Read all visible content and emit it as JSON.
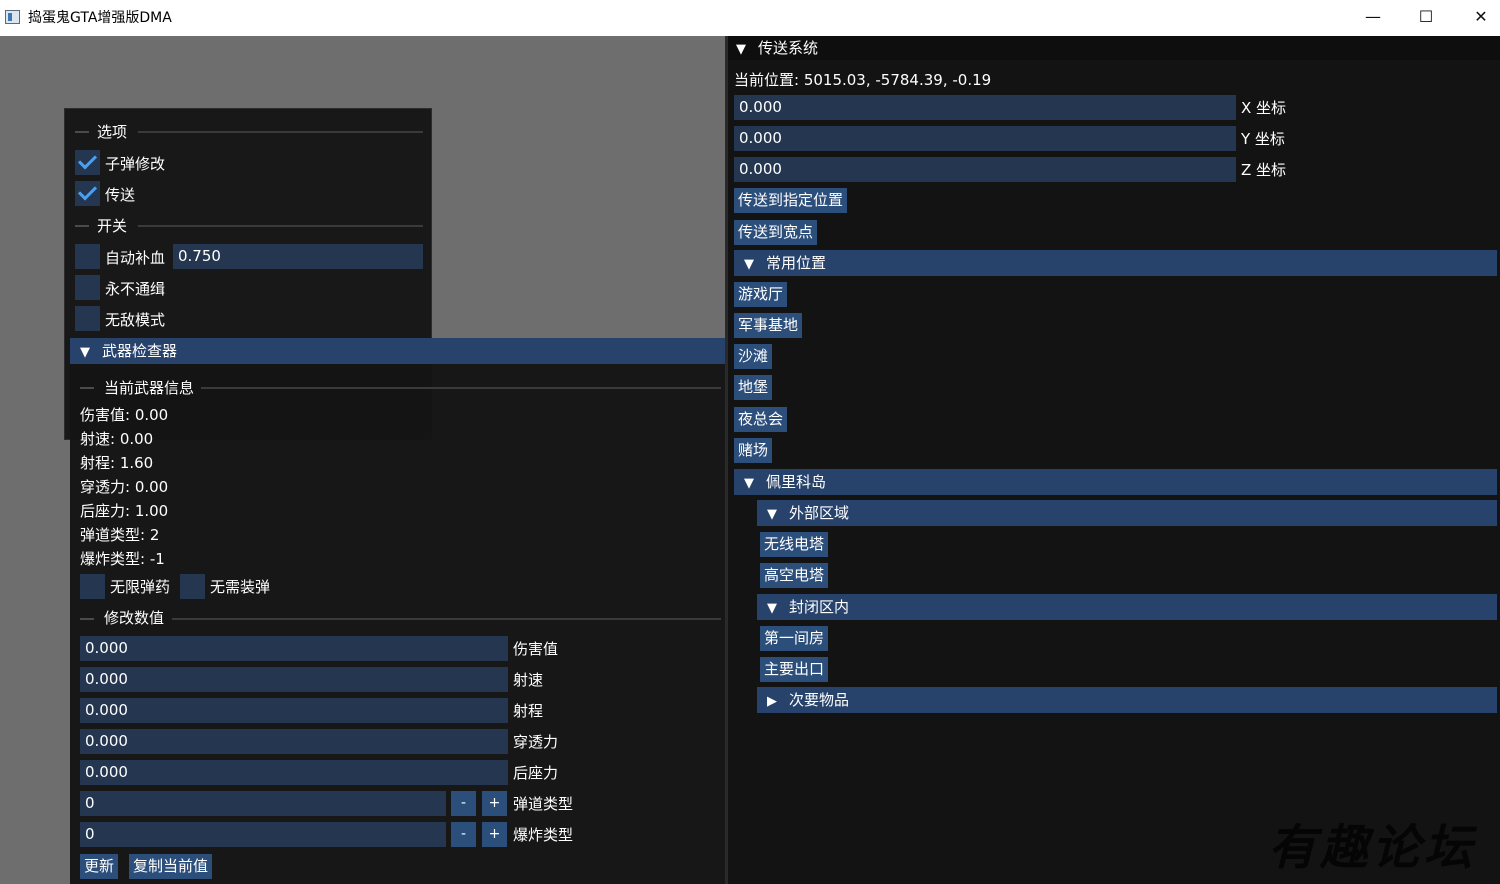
{
  "window": {
    "title": "捣蛋鬼GTA增强版DMA",
    "minimize": "—",
    "maximize": "☐",
    "close": "✕"
  },
  "options_panel": {
    "section_options": "选项",
    "bullet_mod": "子弹修改",
    "teleport": "传送",
    "section_switch": "开关",
    "auto_heal": "自动补血",
    "auto_heal_value": "0.750",
    "never_wanted": "永不通缉",
    "god_mode": "无敌模式"
  },
  "weapon_panel": {
    "header": "武器检查器",
    "section_info": "当前武器信息",
    "stats": [
      "伤害值: 0.00",
      "射速: 0.00",
      "射程: 1.60",
      "穿透力: 0.00",
      "后座力: 1.00",
      "弹道类型: 2",
      "爆炸类型: -1"
    ],
    "infinite_ammo": "无限弹药",
    "no_reload": "无需装弹",
    "section_modify": "修改数值",
    "fields": [
      {
        "value": "0.000",
        "label": "伤害值"
      },
      {
        "value": "0.000",
        "label": "射速"
      },
      {
        "value": "0.000",
        "label": "射程"
      },
      {
        "value": "0.000",
        "label": "穿透力"
      },
      {
        "value": "0.000",
        "label": "后座力"
      }
    ],
    "steppers": [
      {
        "value": "0",
        "label": "弹道类型",
        "minus": "-",
        "plus": "+"
      },
      {
        "value": "0",
        "label": "爆炸类型",
        "minus": "-",
        "plus": "+"
      }
    ],
    "update_button": "更新",
    "copy_button": "复制当前值"
  },
  "teleport_panel": {
    "header": "传送系统",
    "current_position": "当前位置: 5015.03, -5784.39, -0.19",
    "coords": [
      {
        "value": "0.000",
        "label": "X 坐标"
      },
      {
        "value": "0.000",
        "label": "Y 坐标"
      },
      {
        "value": "0.000",
        "label": "Z 坐标"
      }
    ],
    "teleport_to_position": "传送到指定位置",
    "teleport_to_waypoint": "传送到宽点",
    "common_locations": {
      "header": "常用位置",
      "items": [
        "游戏厅",
        "军事基地",
        "沙滩",
        "地堡",
        "夜总会",
        "赌场"
      ]
    },
    "cayo_perico": {
      "header": "佩里科岛",
      "outer_area": {
        "header": "外部区域",
        "items": [
          "无线电塔",
          "高空电塔"
        ]
      },
      "compound": {
        "header": "封闭区内",
        "items": [
          "第一间房",
          "主要出口"
        ]
      },
      "secondary": {
        "header": "次要物品"
      }
    }
  },
  "watermark": "有趣论坛"
}
